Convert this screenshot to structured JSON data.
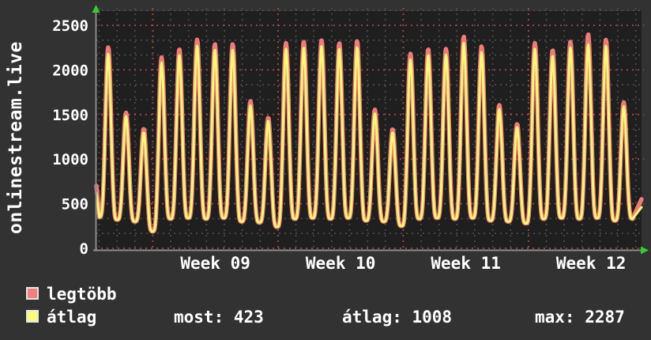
{
  "page_bg": "#323232",
  "vertical_title": "onlinestream.live",
  "legend": {
    "series": [
      {
        "label": "legtöbb",
        "color": "#f08080"
      },
      {
        "label": "átlag",
        "color": "#fcfa7d"
      }
    ],
    "stats": [
      {
        "name": "most",
        "value": 423,
        "text": "most: 423"
      },
      {
        "name": "átlag",
        "value": 1008,
        "text": "átlag: 1008"
      },
      {
        "name": "max",
        "value": 2287,
        "text": "max: 2287"
      }
    ]
  },
  "chart_data": {
    "type": "line",
    "title": "onlinestream.live",
    "ylim": [
      0,
      2500
    ],
    "y_ticks": [
      0,
      500,
      1000,
      1500,
      2000,
      2500
    ],
    "x_tick_labels": [
      "Week 09",
      "Week 10",
      "Week 11",
      "Week 12"
    ],
    "grid": {
      "y_major_step": 500,
      "y_minor_per_major": 3,
      "x_minor": "day",
      "x_major": "week"
    },
    "legend_position": "bottom-left",
    "colors": {
      "plot_bg": "#1f1f1f",
      "page_bg": "#323232",
      "grid_minor": "#4f4f4f",
      "grid_major_red": "#a84848",
      "axis": "#8a8a8a",
      "arrow_green": "#33cc33",
      "max_line": "#ef7d76",
      "avg_line": "#fbf877",
      "text": "#ffffff"
    },
    "series": [
      {
        "name": "legtöbb",
        "role": "max",
        "color": "#ef7d76",
        "daily_peaks": [
          2255,
          1520,
          1340,
          2140,
          2235,
          2340,
          2290,
          2290,
          1650,
          1465,
          2300,
          2320,
          2330,
          2300,
          2325,
          1555,
          1335,
          2180,
          2235,
          2235,
          2375,
          2265,
          1605,
          1395,
          2300,
          2225,
          2315,
          2400,
          2340,
          1635
        ],
        "edge_start": 700,
        "edge_end": 550
      },
      {
        "name": "átlag",
        "role": "average",
        "color": "#fbf877",
        "daily_peaks": [
          2180,
          1480,
          1300,
          2080,
          2170,
          2270,
          2225,
          2225,
          1600,
          1430,
          2235,
          2255,
          2265,
          2235,
          2255,
          1510,
          1300,
          2115,
          2170,
          2170,
          2305,
          2200,
          1560,
          1360,
          2235,
          2160,
          2250,
          2287,
          2270,
          1590
        ],
        "edge_start": 620,
        "edge_end": 460
      }
    ],
    "night_troughs": [
      320,
      300,
      190,
      330,
      340,
      330,
      340,
      300,
      290,
      240,
      330,
      340,
      330,
      340,
      310,
      300,
      250,
      330,
      340,
      330,
      340,
      310,
      300,
      280,
      330,
      340,
      330,
      340,
      310,
      330
    ],
    "start_trough": 350,
    "stats": {
      "most": 423,
      "átlag": 1008,
      "max": 2287
    }
  }
}
